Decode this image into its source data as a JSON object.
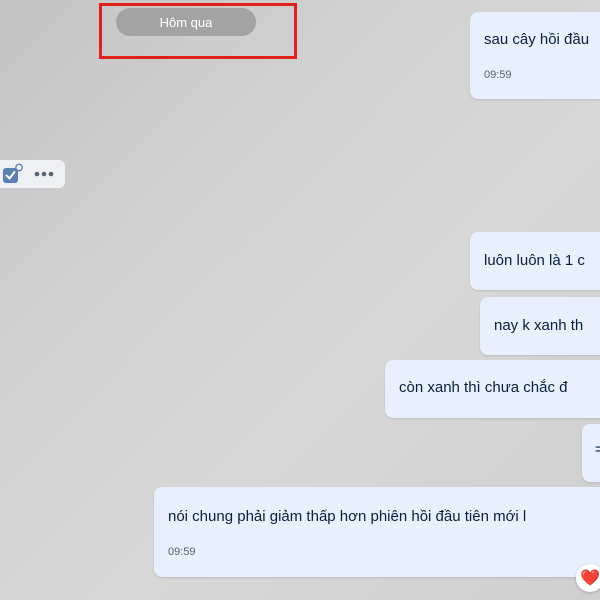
{
  "date_separator": {
    "label": "Hôm qua"
  },
  "action_bar": {
    "icons": [
      "reaction-check-icon",
      "more-options-icon"
    ]
  },
  "messages": [
    {
      "text": "sau cây hồi đầu",
      "time": "09:59"
    },
    {
      "text": "luôn luôn là 1 c"
    },
    {
      "text": "nay k xanh th"
    },
    {
      "text": "còn xanh thì chưa chắc đ"
    },
    {
      "text": "="
    },
    {
      "text": "nói chung phải giảm thấp hơn phiên hồi đầu tiên mới l",
      "time": "09:59"
    }
  ],
  "reaction": {
    "emoji": "❤️"
  },
  "colors": {
    "bubble": "#e8f0fd",
    "highlight": "#e0211b",
    "date_pill": "#a3a3a3"
  }
}
